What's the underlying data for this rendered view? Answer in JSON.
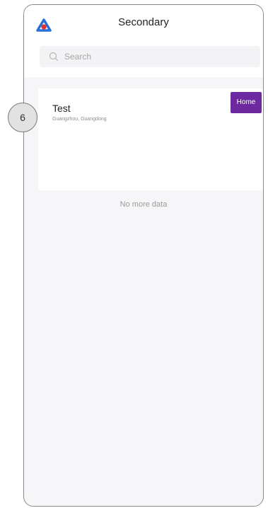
{
  "header": {
    "title": "Secondary",
    "logo_icon": "app-logo-icon"
  },
  "search": {
    "placeholder": "Search",
    "icon": "search-icon"
  },
  "list": {
    "items": [
      {
        "title": "Test",
        "subtitle": "Guangzhou, Guangdong",
        "badge": "Home"
      }
    ],
    "end_text": "No more data"
  },
  "step_marker": {
    "number": "6"
  },
  "colors": {
    "badge": "#6d2aa0",
    "logo_blue": "#2a6fd6",
    "logo_red": "#e0302f"
  }
}
